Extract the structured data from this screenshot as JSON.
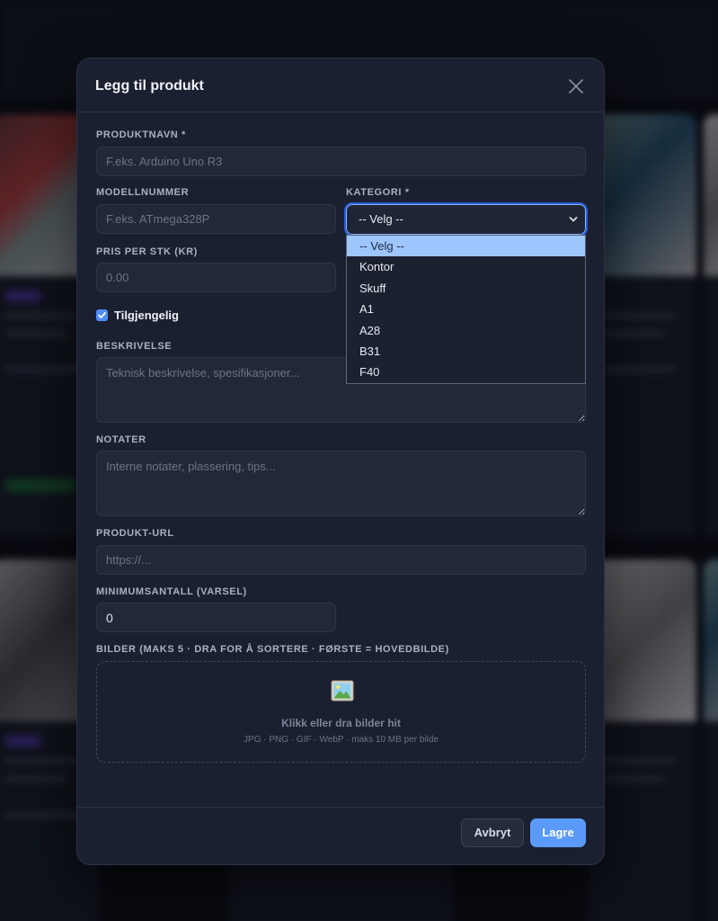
{
  "modal": {
    "title": "Legg til produkt"
  },
  "fields": {
    "name": {
      "label": "PRODUKTNAVN *",
      "placeholder": "F.eks. Arduino Uno R3",
      "value": ""
    },
    "model": {
      "label": "MODELLNUMMER",
      "placeholder": "F.eks. ATmega328P",
      "value": ""
    },
    "category": {
      "label": "KATEGORI *",
      "selected": "-- Velg --",
      "options": [
        "-- Velg --",
        "Kontor",
        "Skuff",
        "A1",
        "A28",
        "B31",
        "F40"
      ]
    },
    "price": {
      "label": "PRIS PER STK (KR)",
      "placeholder": "0.00",
      "value": ""
    },
    "available": {
      "label": "Tilgjengelig",
      "checked": true
    },
    "description": {
      "label": "BESKRIVELSE",
      "placeholder": "Teknisk beskrivelse, spesifikasjoner...",
      "value": ""
    },
    "notes": {
      "label": "NOTATER",
      "placeholder": "Interne notater, plassering, tips...",
      "value": ""
    },
    "url": {
      "label": "PRODUKT-URL",
      "placeholder": "https://...",
      "value": ""
    },
    "min_qty": {
      "label": "MINIMUMSANTALL (VARSEL)",
      "value": "0"
    },
    "images": {
      "label": "BILDER (MAKS 5 · DRA FOR Å SORTERE · FØRSTE = HOVEDBILDE)",
      "drop_title": "Klikk eller dra bilder hit",
      "drop_hint": "JPG · PNG · GIF · WebP · maks 10 MB per bilde"
    }
  },
  "buttons": {
    "cancel": "Avbryt",
    "save": "Lagre"
  },
  "colors": {
    "accent": "#5b9af8",
    "modal_bg": "#1b2030",
    "selected_option": "#9fc5ff"
  },
  "icons": {
    "close": "close-icon",
    "image": "image-icon",
    "chevron": "chevron-down-icon",
    "check": "check-icon"
  }
}
